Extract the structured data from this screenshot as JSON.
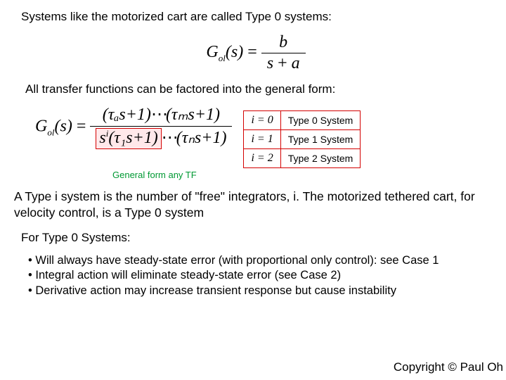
{
  "lines": {
    "intro": "Systems like the motorized cart are called Type 0 systems:",
    "factored": "All transfer functions can be factored into the general form:",
    "caption_green": "General form any TF",
    "body": "A Type i system is the number of \"free\" integrators, i.  The motorized tethered cart, for velocity control, is a Type 0 system",
    "subhead": "For Type 0 Systems:",
    "bullets": [
      "Will always have steady-state error (with proportional only control): see Case 1",
      "Integral action will eliminate steady-state error (see Case 2)",
      "Derivative action may increase transient response but cause instability"
    ],
    "copyright": "Copyright © Paul Oh"
  },
  "eq1": {
    "lhs_sym": "G",
    "lhs_sub": "ol",
    "arg": "s",
    "num": "b",
    "den_lhs": "s",
    "den_op": "+",
    "den_rhs": "a"
  },
  "eq2": {
    "lhs_sym": "G",
    "lhs_sub": "ol",
    "arg": "s",
    "num_terms": [
      "(τₐs+1)",
      "⋯",
      "(τₘs+1)"
    ],
    "den_lead": "s",
    "den_exp": "i",
    "den_terms": [
      "(τ₁s+1)",
      "⋯",
      "(τₙs+1)"
    ]
  },
  "type_rows": [
    {
      "cond": "i = 0",
      "label": "Type 0 System"
    },
    {
      "cond": "i = 1",
      "label": "Type 1 System"
    },
    {
      "cond": "i = 2",
      "label": "Type 2 System"
    }
  ]
}
